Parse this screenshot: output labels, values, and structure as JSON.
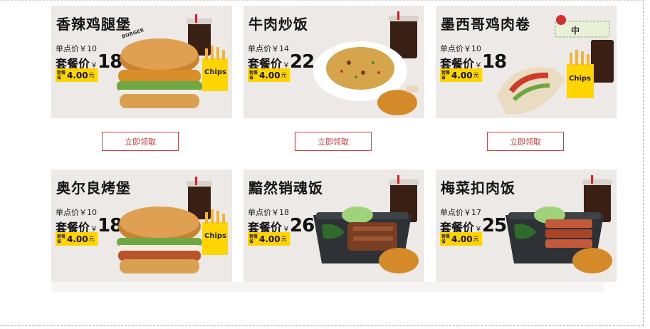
{
  "cards": [
    {
      "name": "香辣鸡腿堡",
      "single_label": "单点价",
      "single_currency": "￥",
      "single_price": "10",
      "combo_label": "套餐价",
      "combo_currency": "￥",
      "combo_price": "18",
      "save_tag": "套餐省",
      "save_amount": "4.00",
      "save_unit": "元",
      "button": "立即领取",
      "image": "chicken-burger-combo",
      "burger_text": "BURGER",
      "chips_text": "Chips"
    },
    {
      "name": "牛肉炒饭",
      "single_label": "单点价",
      "single_currency": "￥",
      "single_price": "14",
      "combo_label": "套餐价",
      "combo_currency": "￥",
      "combo_price": "22",
      "save_tag": "套餐省",
      "save_amount": "4.00",
      "save_unit": "元",
      "button": "立即领取",
      "image": "beef-fried-rice-combo"
    },
    {
      "name": "墨西哥鸡肉卷",
      "single_label": "单点价",
      "single_currency": "￥",
      "single_price": "10",
      "combo_label": "套餐价",
      "combo_currency": "￥",
      "combo_price": "18",
      "save_tag": "套餐省",
      "save_amount": "4.00",
      "save_unit": "元",
      "button": "立即领取",
      "image": "mexican-chicken-wrap-combo",
      "chips_text": "Chips",
      "badge_text": "中"
    },
    {
      "name": "奥尔良烤堡",
      "single_label": "单点价",
      "single_currency": "￥",
      "single_price": "10",
      "combo_label": "套餐价",
      "combo_currency": "￥",
      "combo_price": "18",
      "save_tag": "套餐省",
      "save_amount": "4.00",
      "save_unit": "元",
      "image": "orleans-burger-combo",
      "chips_text": "Chips"
    },
    {
      "name": "黯然销魂饭",
      "single_label": "单点价",
      "single_currency": "￥",
      "single_price": "18",
      "combo_label": "套餐价",
      "combo_currency": "￥",
      "combo_price": "26",
      "save_tag": "套餐省",
      "save_amount": "4.00",
      "save_unit": "元",
      "image": "char-siu-rice-combo"
    },
    {
      "name": "梅菜扣肉饭",
      "single_label": "单点价",
      "single_currency": "￥",
      "single_price": "17",
      "combo_label": "套餐价",
      "combo_currency": "￥",
      "combo_price": "25",
      "save_tag": "套餐省",
      "save_amount": "4.00",
      "save_unit": "元",
      "image": "preserved-veg-pork-rice-combo"
    }
  ],
  "colors": {
    "card_bg": "#ece9e6",
    "button_red": "#d03c3c",
    "save_yellow": "#ffd400"
  }
}
